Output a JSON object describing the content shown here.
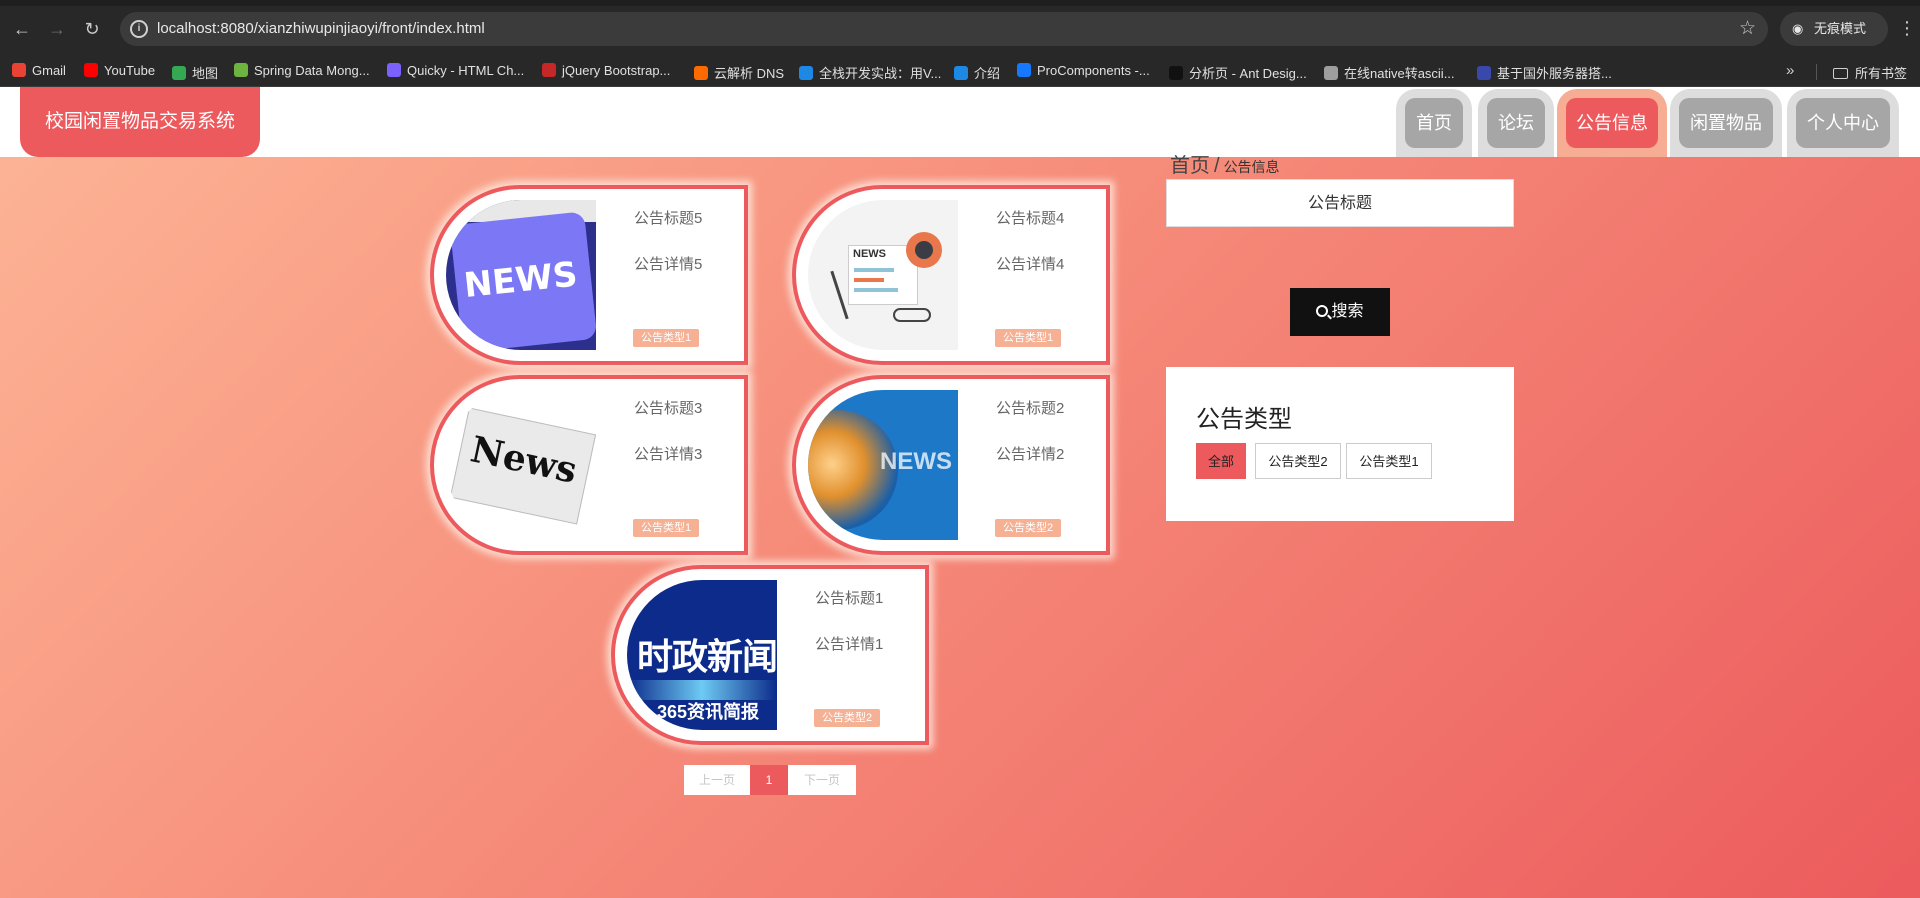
{
  "browser": {
    "url": "localhost:8080/xianzhiwupinjiaoyi/front/index.html",
    "incognito_label": "无痕模式",
    "bookmarks": [
      {
        "label": "Gmail",
        "color": "#ea4335"
      },
      {
        "label": "YouTube",
        "color": "#ff0000"
      },
      {
        "label": "地图",
        "color": "#34a853"
      },
      {
        "label": "Spring Data Mong...",
        "color": "#6db33f"
      },
      {
        "label": "Quicky - HTML Ch...",
        "color": "#7b61ff"
      },
      {
        "label": "jQuery Bootstrap...",
        "color": "#c62828"
      },
      {
        "label": "云解析 DNS",
        "color": "#ff6a00"
      },
      {
        "label": "全栈开发实战：用V...",
        "color": "#1e88e5"
      },
      {
        "label": "介绍",
        "color": "#1e88e5"
      },
      {
        "label": "ProComponents -...",
        "color": "#1677ff"
      },
      {
        "label": "分析页 - Ant Desig...",
        "color": "#111111"
      },
      {
        "label": "在线native转ascii...",
        "color": "#9e9e9e"
      },
      {
        "label": "基于国外服务器搭...",
        "color": "#3949ab"
      }
    ],
    "all_bookmarks_label": "所有书签"
  },
  "site": {
    "logo": "校园闲置物品交易系统",
    "nav": [
      "首页",
      "论坛",
      "公告信息",
      "闲置物品",
      "个人中心"
    ],
    "active_nav": "公告信息"
  },
  "cards": [
    {
      "title": "公告标题5",
      "detail": "公告详情5",
      "type": "公告类型1",
      "image": "news-keyboard-image"
    },
    {
      "title": "公告标题4",
      "detail": "公告详情4",
      "type": "公告类型1",
      "image": "newspaper-coffee-image"
    },
    {
      "title": "公告标题3",
      "detail": "公告详情3",
      "type": "公告类型1",
      "image": "newspaper-image"
    },
    {
      "title": "公告标题2",
      "detail": "公告详情2",
      "type": "公告类型2",
      "image": "globe-news-image"
    },
    {
      "title": "公告标题1",
      "detail": "公告详情1",
      "type": "公告类型2",
      "image": "shizheng-news-image"
    }
  ],
  "pagination": {
    "prev": "上一页",
    "current": "1",
    "next": "下一页"
  },
  "sidebar": {
    "breadcrumb_home": "首页",
    "breadcrumb_sep": "/",
    "breadcrumb_current": "公告信息",
    "search_placeholder": "公告标题",
    "search_button": "搜索",
    "type_title": "公告类型",
    "types": [
      "全部",
      "公告类型2",
      "公告类型1"
    ],
    "active_type": "全部"
  },
  "colors": {
    "accent": "#ec5a5e",
    "tag": "#f6b094",
    "nav_inactive": "#a6a6a6"
  },
  "image_text": {
    "news_key": "NEWS",
    "news_paper": "NEWS",
    "newspaper": "News",
    "globe": "NEWS",
    "shizheng_1": "时政新闻",
    "shizheng_2": "365资讯简报"
  }
}
